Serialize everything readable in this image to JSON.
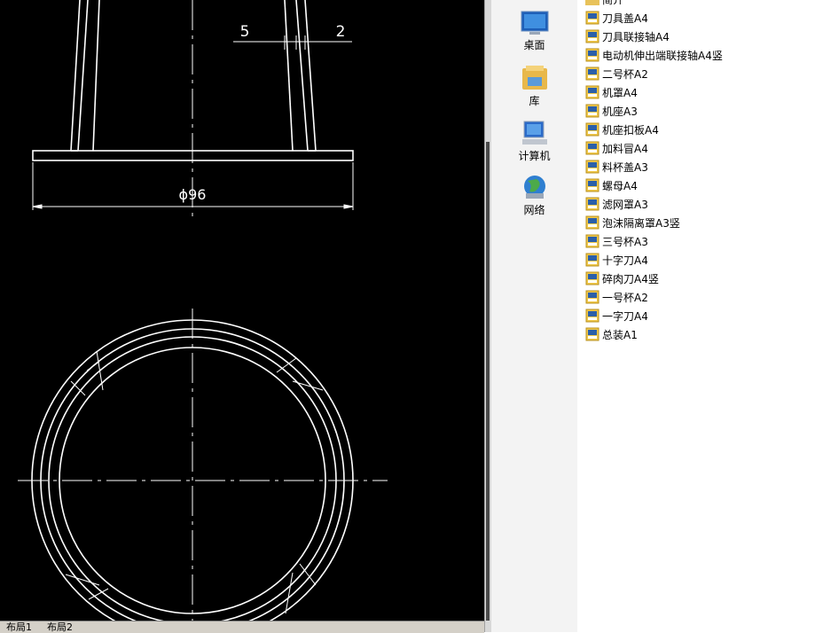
{
  "drawing": {
    "dim_left": "5",
    "dim_right": "2",
    "dim_diameter": "ϕ96"
  },
  "layout_tabs": [
    "布局1",
    "布局2"
  ],
  "nav": [
    {
      "label": "桌面",
      "icon": "desktop-icon"
    },
    {
      "label": "库",
      "icon": "library-icon"
    },
    {
      "label": "计算机",
      "icon": "computer-icon"
    },
    {
      "label": "网络",
      "icon": "network-icon"
    }
  ],
  "files": {
    "partial_top": "简介",
    "items": [
      "刀具盖A4",
      "刀具联接轴A4",
      "电动机伸出端联接轴A4竖",
      "二号杯A2",
      "机罩A4",
      "机座A3",
      "机座扣板A4",
      "加料冒A4",
      "料杯盖A3",
      "螺母A4",
      "滤网罩A3",
      "泡沫隔离罩A3竖",
      "三号杯A3",
      "十字刀A4",
      "碎肉刀A4竖",
      "一号杯A2",
      "一字刀A4",
      "总装A1"
    ]
  }
}
